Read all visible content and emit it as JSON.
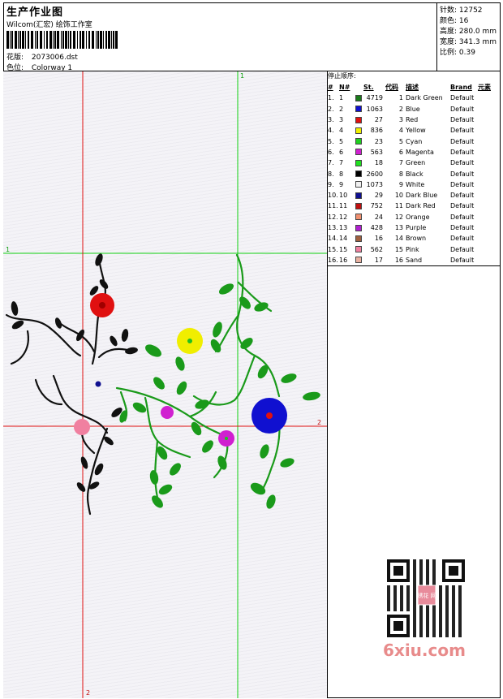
{
  "header": {
    "title": "生产作业图",
    "company": "Wilcom(汇宏) 绘饰工作室",
    "design_label": "花版:",
    "design_value": "2073006.dst",
    "colorway_label": "色位:",
    "colorway_value": "Colorway 1"
  },
  "specs": {
    "stitches": "针数: 12752",
    "colors": "颜色: 16",
    "height": "高度: 280.0 mm",
    "width": "宽度: 341.3 mm",
    "scale": "比例: 0.39"
  },
  "stop_sequence": {
    "title": "停止顺序:",
    "headers": {
      "idx": "#",
      "n": "N#",
      "st": "St.",
      "code": "代码",
      "desc": "描述",
      "brand": "Brand",
      "element": "元素"
    },
    "rows": [
      {
        "idx": "1.",
        "n": "1",
        "color": "#1a7a1a",
        "st": "4719",
        "code": "1",
        "desc": "Dark Green",
        "brand": "Default"
      },
      {
        "idx": "2.",
        "n": "2",
        "color": "#1010d0",
        "st": "1063",
        "code": "2",
        "desc": "Blue",
        "brand": "Default"
      },
      {
        "idx": "3.",
        "n": "3",
        "color": "#e01010",
        "st": "27",
        "code": "3",
        "desc": "Red",
        "brand": "Default"
      },
      {
        "idx": "4.",
        "n": "4",
        "color": "#f0f000",
        "st": "836",
        "code": "4",
        "desc": "Yellow",
        "brand": "Default"
      },
      {
        "idx": "5.",
        "n": "5",
        "color": "#20d020",
        "st": "23",
        "code": "5",
        "desc": "Cyan",
        "brand": "Default"
      },
      {
        "idx": "6.",
        "n": "6",
        "color": "#d020d0",
        "st": "563",
        "code": "6",
        "desc": "Magenta",
        "brand": "Default"
      },
      {
        "idx": "7.",
        "n": "7",
        "color": "#20e020",
        "st": "18",
        "code": "7",
        "desc": "Green",
        "brand": "Default"
      },
      {
        "idx": "8.",
        "n": "8",
        "color": "#000000",
        "st": "2600",
        "code": "8",
        "desc": "Black",
        "brand": "Default"
      },
      {
        "idx": "9.",
        "n": "9",
        "color": "#f0f0f0",
        "st": "1073",
        "code": "9",
        "desc": "White",
        "brand": "Default"
      },
      {
        "idx": "10.",
        "n": "10",
        "color": "#101090",
        "st": "29",
        "code": "10",
        "desc": "Dark Blue",
        "brand": "Default"
      },
      {
        "idx": "11.",
        "n": "11",
        "color": "#c01010",
        "st": "752",
        "code": "11",
        "desc": "Dark Red",
        "brand": "Default"
      },
      {
        "idx": "12.",
        "n": "12",
        "color": "#f09070",
        "st": "24",
        "code": "12",
        "desc": "Orange",
        "brand": "Default"
      },
      {
        "idx": "13.",
        "n": "13",
        "color": "#b020d0",
        "st": "428",
        "code": "13",
        "desc": "Purple",
        "brand": "Default"
      },
      {
        "idx": "14.",
        "n": "14",
        "color": "#a06040",
        "st": "16",
        "code": "14",
        "desc": "Brown",
        "brand": "Default"
      },
      {
        "idx": "15.",
        "n": "15",
        "color": "#f080a0",
        "st": "562",
        "code": "15",
        "desc": "Pink",
        "brand": "Default"
      },
      {
        "idx": "16.",
        "n": "16",
        "color": "#e8b0a0",
        "st": "17",
        "code": "16",
        "desc": "Sand",
        "brand": "Default"
      }
    ]
  },
  "guides": {
    "v_green_top": "1",
    "h_green_left": "1",
    "h_red_right": "2",
    "v_red_bottom": "2"
  },
  "watermark": "6xiu.com",
  "qr_stamp": "绣花 网"
}
